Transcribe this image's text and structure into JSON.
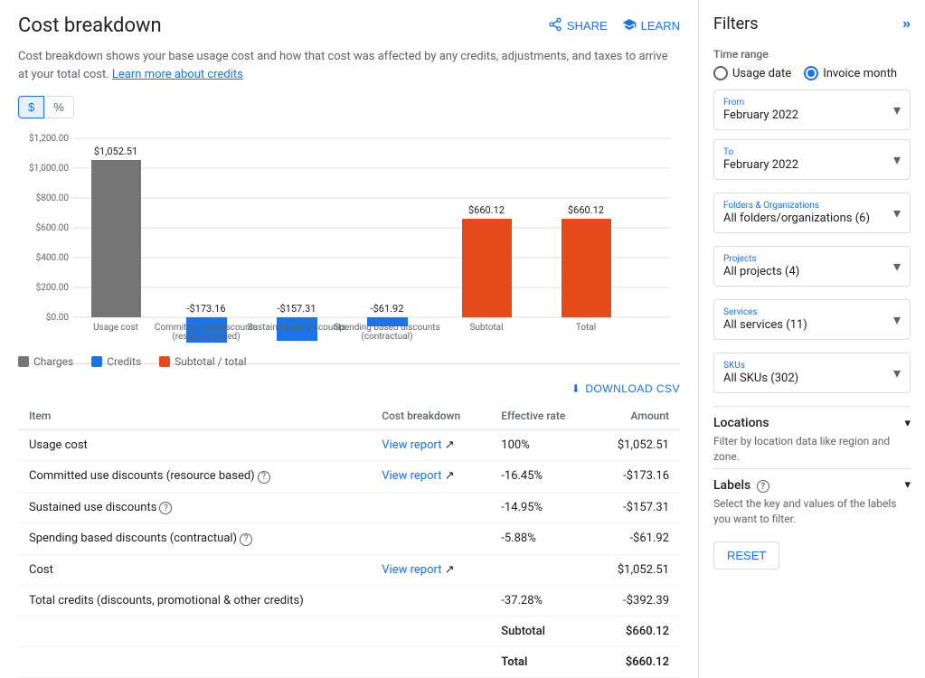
{
  "page": {
    "title": "Cost breakdown",
    "share_label": "SHARE",
    "learn_label": "LEARN",
    "description": "Cost breakdown shows your base usage cost and how that cost was affected by any credits, adjustments, and taxes to arrive at your total cost.",
    "description_link": "Learn more about credits"
  },
  "toggle": {
    "dollar_label": "$",
    "percent_label": "%",
    "active": "dollar"
  },
  "chart": {
    "bars": [
      {
        "label": "Usage cost",
        "value": 1052.51,
        "display": "$1,052.51",
        "type": "charge",
        "color": "#757575"
      },
      {
        "label": "Committed use discounts\n(resource based)",
        "value": -173.16,
        "display": "-$173.16",
        "type": "credit",
        "color": "#1a73e8"
      },
      {
        "label": "Sustained use discounts",
        "value": -157.31,
        "display": "-$157.31",
        "type": "credit",
        "color": "#1a73e8"
      },
      {
        "label": "Spending based discounts\n(contractual)",
        "value": -61.92,
        "display": "-$61.92",
        "type": "credit",
        "color": "#1a73e8"
      },
      {
        "label": "Subtotal",
        "value": 660.12,
        "display": "$660.12",
        "type": "subtotal",
        "color": "#e64a19"
      },
      {
        "label": "Total",
        "value": 660.12,
        "display": "$660.12",
        "type": "total",
        "color": "#e64a19"
      }
    ],
    "y_axis_labels": [
      "$0.00",
      "$200.00",
      "$400.00",
      "$600.00",
      "$800.00",
      "$1,000.00",
      "$1,200.00"
    ],
    "legend": [
      {
        "label": "Charges",
        "color": "#757575"
      },
      {
        "label": "Credits",
        "color": "#1a73e8"
      },
      {
        "label": "Subtotal / total",
        "color": "#e64a19"
      }
    ]
  },
  "table": {
    "download_label": "DOWNLOAD CSV",
    "columns": [
      "Item",
      "Cost breakdown",
      "Effective rate",
      "Amount"
    ],
    "rows": [
      {
        "item": "Usage cost",
        "cost_breakdown": "View report",
        "effective_rate": "100%",
        "amount": "$1,052.51",
        "has_help": false
      },
      {
        "item": "Committed use discounts (resource based)",
        "cost_breakdown": "View report",
        "effective_rate": "-16.45%",
        "amount": "-$173.16",
        "has_help": true
      },
      {
        "item": "Sustained use discounts",
        "cost_breakdown": "",
        "effective_rate": "-14.95%",
        "amount": "-$157.31",
        "has_help": true
      },
      {
        "item": "Spending based discounts (contractual)",
        "cost_breakdown": "",
        "effective_rate": "-5.88%",
        "amount": "-$61.92",
        "has_help": true
      },
      {
        "item": "Cost",
        "cost_breakdown": "View report",
        "effective_rate": "",
        "amount": "$1,052.51",
        "has_help": false
      },
      {
        "item": "Total credits (discounts, promotional & other credits)",
        "cost_breakdown": "",
        "effective_rate": "-37.28%",
        "amount": "-$392.39",
        "has_help": false
      }
    ],
    "subtotal_row": {
      "item": "",
      "label": "Subtotal",
      "amount": "$660.12"
    },
    "total_row": {
      "item": "",
      "label": "Total",
      "amount": "$660.12"
    }
  },
  "filters": {
    "title": "Filters",
    "time_range_label": "Time range",
    "usage_date_label": "Usage date",
    "invoice_month_label": "Invoice month",
    "from_label": "From",
    "from_value": "February 2022",
    "to_label": "To",
    "to_value": "February 2022",
    "folders_label": "Folders & Organizations",
    "folders_value": "All folders/organizations (6)",
    "projects_label": "Projects",
    "projects_value": "All projects (4)",
    "services_label": "Services",
    "services_value": "All services (11)",
    "skus_label": "SKUs",
    "skus_value": "All SKUs (302)",
    "locations_label": "Locations",
    "locations_desc": "Filter by location data like region and zone.",
    "labels_label": "Labels",
    "labels_desc": "Select the key and values of the labels you want to filter.",
    "reset_label": "RESET"
  }
}
